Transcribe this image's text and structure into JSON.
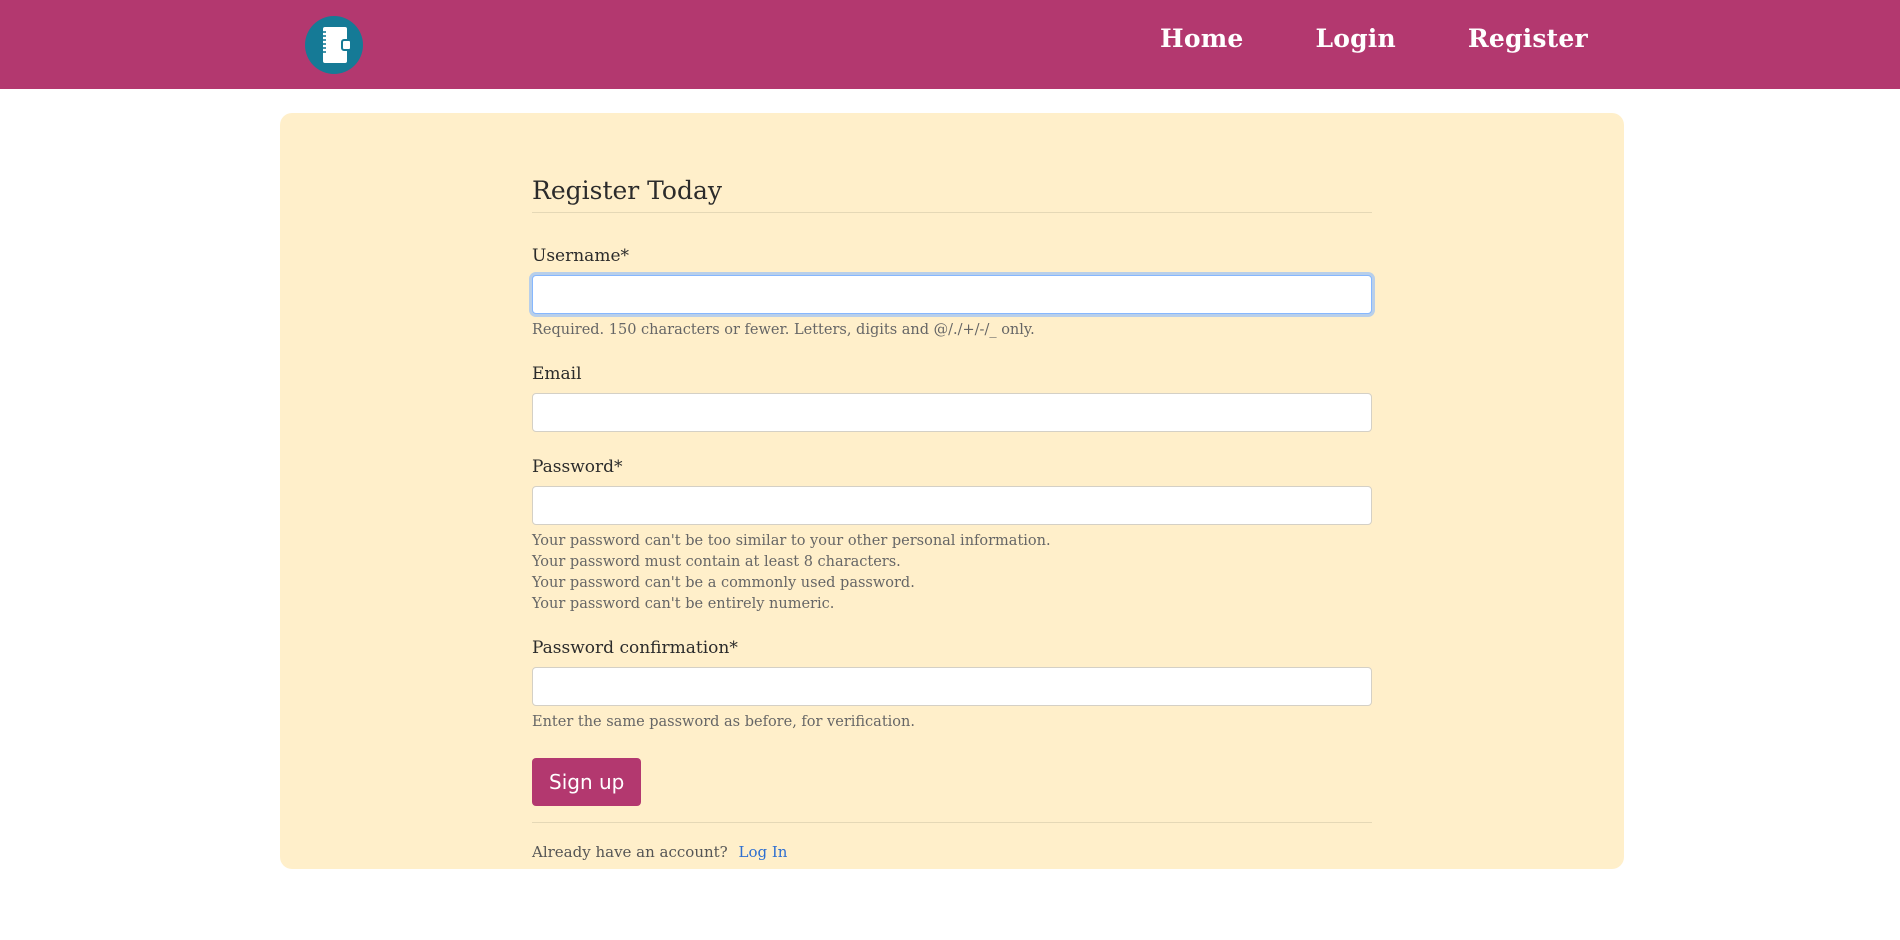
{
  "navbar": {
    "logo_icon": "notebook-icon",
    "brand_color": "#b3386f",
    "logo_bg_color": "#157a96",
    "links": [
      "Home",
      "Login",
      "Register"
    ]
  },
  "form": {
    "title": "Register Today",
    "username_label": "Username*",
    "username_value": "",
    "username_help": "Required. 150 characters or fewer. Letters, digits and @/./+/-/_ only.",
    "email_label": "Email",
    "email_value": "",
    "password_label": "Password*",
    "password_value": "",
    "password_help": [
      "Your password can't be too similar to your other personal information.",
      "Your password must contain at least 8 characters.",
      "Your password can't be a commonly used password.",
      "Your password can't be entirely numeric."
    ],
    "password_confirm_label": "Password confirmation*",
    "password_confirm_value": "",
    "password_confirm_help": "Enter the same password as before, for verification.",
    "submit_label": "Sign up",
    "footer_text": "Already have an account?",
    "footer_link": "Log In"
  },
  "colors": {
    "card_bg": "#ffefca",
    "accent": "#b3386f",
    "link": "#2f6fd0"
  }
}
